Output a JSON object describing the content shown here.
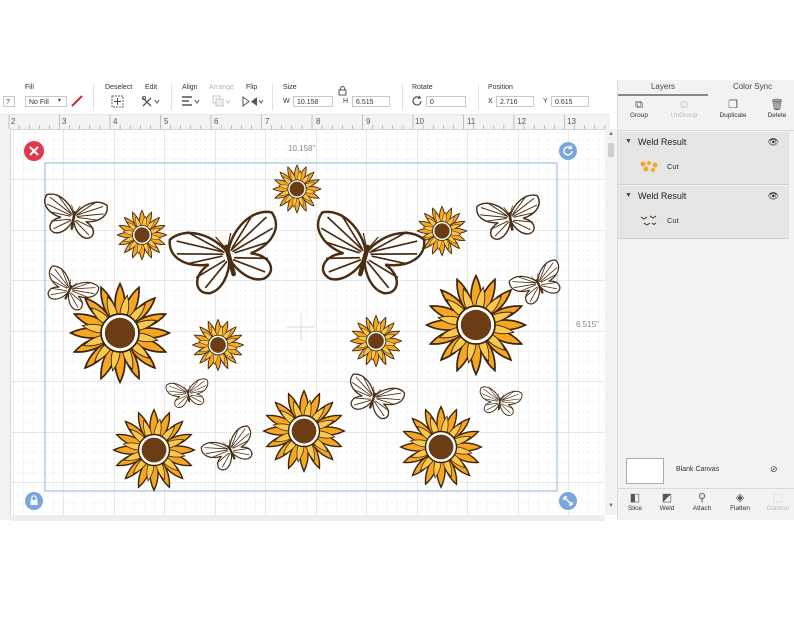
{
  "toolbar": {
    "help_label": "?",
    "fill": {
      "label": "Fill",
      "value": "No Fill",
      "pen_color": "#d62828"
    },
    "deselect_label": "Deselect",
    "edit_label": "Edit",
    "align_label": "Align",
    "arrange_label": "Arrange",
    "flip_label": "Flip",
    "size": {
      "label": "Size",
      "w_label": "W",
      "w_value": "10.158",
      "h_label": "H",
      "h_value": "6.515"
    },
    "rotate": {
      "label": "Rotate",
      "value": "0"
    },
    "position": {
      "label": "Position",
      "x_label": "X",
      "x_value": "2.716",
      "y_label": "Y",
      "y_value": "0.615"
    }
  },
  "ruler": {
    "ticks": [
      "2",
      "3",
      "4",
      "5",
      "6",
      "7",
      "8",
      "9",
      "10",
      "11",
      "12",
      "13"
    ]
  },
  "canvas": {
    "width_readout": "10.158\"",
    "height_readout": "6.515\"",
    "selection_color": "#8fb4e3",
    "handle_delete_color": "#e0394d",
    "handle_color": "#7aa7da",
    "colors": {
      "petal": "#f5a623",
      "petal_light": "#f9c94d",
      "center": "#6b3d14",
      "outline": "#3a2410",
      "wing": "#4a2e14"
    }
  },
  "panel": {
    "tabs": [
      "Layers",
      "Color Sync"
    ],
    "tools": [
      {
        "label": "Group",
        "icon": "group-icon",
        "enabled": true
      },
      {
        "label": "UnGroup",
        "icon": "ungroup-icon",
        "enabled": false
      },
      {
        "label": "Duplicate",
        "icon": "duplicate-icon",
        "enabled": true
      },
      {
        "label": "Delete",
        "icon": "delete-icon",
        "enabled": true
      }
    ],
    "layers": [
      {
        "title": "Weld Result",
        "sub": "Cut"
      },
      {
        "title": "Weld Result",
        "sub": "Cut"
      }
    ],
    "blank_canvas_label": "Blank Canvas",
    "bottom_tools": [
      {
        "label": "Slice",
        "icon": "slice-icon",
        "enabled": true
      },
      {
        "label": "Weld",
        "icon": "weld-icon",
        "enabled": true
      },
      {
        "label": "Attach",
        "icon": "attach-icon",
        "enabled": true
      },
      {
        "label": "Flatten",
        "icon": "flatten-icon",
        "enabled": true
      },
      {
        "label": "Contour",
        "icon": "contour-icon",
        "enabled": false
      }
    ]
  }
}
